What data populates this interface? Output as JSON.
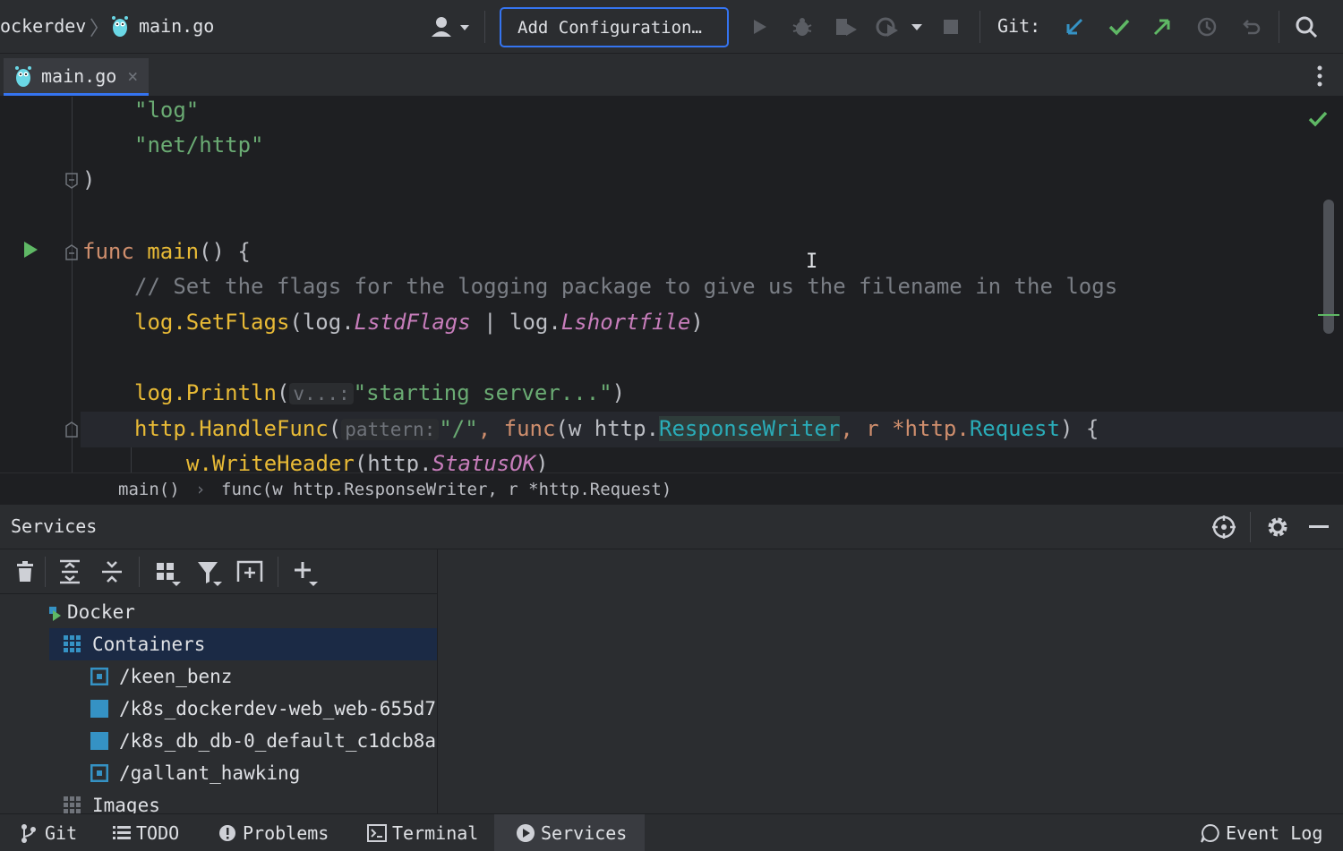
{
  "colors": {
    "accent": "#3574f0",
    "git_update": "#3592c4",
    "git_commit": "#5fb865",
    "git_push": "#5fb865",
    "run_green": "#5fb865"
  },
  "toolbar": {
    "project_name": "ockerdev",
    "file_name": "main.go",
    "add_configuration_label": "Add Configuration…",
    "git_label": "Git:",
    "icons": [
      "user-icon",
      "run-icon",
      "debug-icon",
      "coverage-icon",
      "profile-icon",
      "stop-icon",
      "git-update-icon",
      "git-commit-icon",
      "git-push-icon",
      "history-icon",
      "rollback-icon",
      "search-icon"
    ]
  },
  "tabs": {
    "items": [
      {
        "label": "main.go"
      }
    ]
  },
  "editor": {
    "lines": {
      "l1": "\"log\"",
      "l2": "\"net/http\"",
      "l3": ")",
      "l4_k": "func",
      "l4_fn": "main",
      "l4_rest": "() {",
      "l5": "// Set the flags for the logging package to give us the filename in the logs",
      "l6_a": "log.",
      "l6_b": "SetFlags",
      "l6_c": "(log.",
      "l6_d": "LstdFlags",
      "l6_e": " | log.",
      "l6_f": "Lshortfile",
      "l6_g": ")",
      "l7_a": "log.",
      "l7_b": "Println",
      "l7_c": "(",
      "l7_hint": "v...:",
      "l7_str": "\"starting server...\"",
      "l7_end": ")",
      "l8_a": "http.",
      "l8_b": "HandleFunc",
      "l8_c": "(",
      "l8_hint": "pattern:",
      "l8_str": "\"/\"",
      "l8_comma": ", ",
      "l8_func": "func",
      "l8_d": "(w http.",
      "l8_e": "ResponseWriter",
      "l8_f": ", r *http.",
      "l8_g": "Request",
      "l8_h": ") {",
      "l9_a": "w.",
      "l9_b": "WriteHeader",
      "l9_c": "(http.",
      "l9_d": "StatusOK",
      "l9_e": ")"
    }
  },
  "breadcrumbs": {
    "first": "main()",
    "sep": "›",
    "second": "func(w http.ResponseWriter, r *http.Request)"
  },
  "services": {
    "title": "Services",
    "tree": {
      "docker": "Docker",
      "containers": "Containers",
      "items": [
        "/keen_benz",
        "/k8s_dockerdev-web_web-655d7",
        "/k8s_db_db-0_default_c1dcb8a",
        "/gallant_hawking"
      ],
      "images": "Images"
    }
  },
  "statusbar": {
    "git": "Git",
    "todo": "TODO",
    "problems": "Problems",
    "terminal": "Terminal",
    "services": "Services",
    "event_log": "Event Log"
  }
}
